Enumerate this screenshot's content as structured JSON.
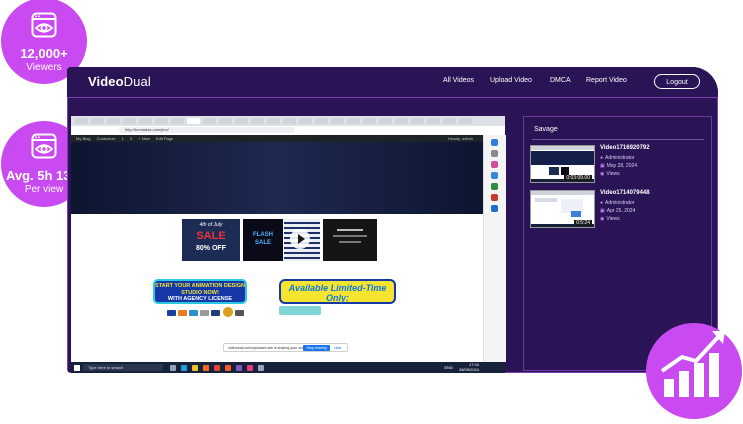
{
  "brand": {
    "name_bold": "Video",
    "name_regular": "Dual"
  },
  "nav": {
    "items": [
      "All Videos",
      "Upload Video",
      "DMCA",
      "Report Video"
    ],
    "logout_label": "Logout"
  },
  "stats": [
    {
      "value": "12,000+",
      "label": "Viewers",
      "icon": "eye-window-icon"
    },
    {
      "value": "Avg. 5h 13m",
      "label": "Per view",
      "icon": "eye-window-icon"
    }
  ],
  "growth_icon": "growth-chart-icon",
  "sidebar": {
    "title": "Savage",
    "videos": [
      {
        "title": "Video1716920792",
        "author": "Administrator",
        "date": "May 28, 2024",
        "views": "Views",
        "duration": "0:03:09.00"
      },
      {
        "title": "Video1714079448",
        "author": "Administrator",
        "date": "Apr 25, 2024",
        "views": "Views",
        "duration": "0:5:24"
      }
    ]
  },
  "player": {
    "url": "http://bomadas.com/jmo/",
    "wp_bar_items": [
      "My Blog",
      "Customize",
      "1",
      "0",
      "+ New",
      "Edit Page"
    ],
    "wp_greeting": "Howdy, admin",
    "promo_left": [
      "START YOUR ANIMATION DESIGN",
      "STUDIO NOW!",
      "WITH AGENCY LICENSE"
    ],
    "promo_right": "Available Limited-Time Only:",
    "sale_cards": [
      {
        "top": "4th of July",
        "main": "SALE",
        "sub": "80% OFF"
      },
      {
        "top": "",
        "main": "FLASH SALE",
        "sub": ""
      },
      {
        "top": "",
        "main": "",
        "sub": ""
      },
      {
        "top": "",
        "main": "",
        "sub": ""
      }
    ],
    "share_text": "videodual.com/uploader-site is sharing your screen",
    "stop_label": "Stop sharing",
    "hide_label": "Hide",
    "taskbar_search": "Type here to search",
    "clock_time": "17:34",
    "clock_date": "28/05/2024",
    "lang": "ENG"
  },
  "colors": {
    "app_bg": "#2a1456",
    "bubble": "#c94af0",
    "accent_purple": "#c58bff"
  }
}
